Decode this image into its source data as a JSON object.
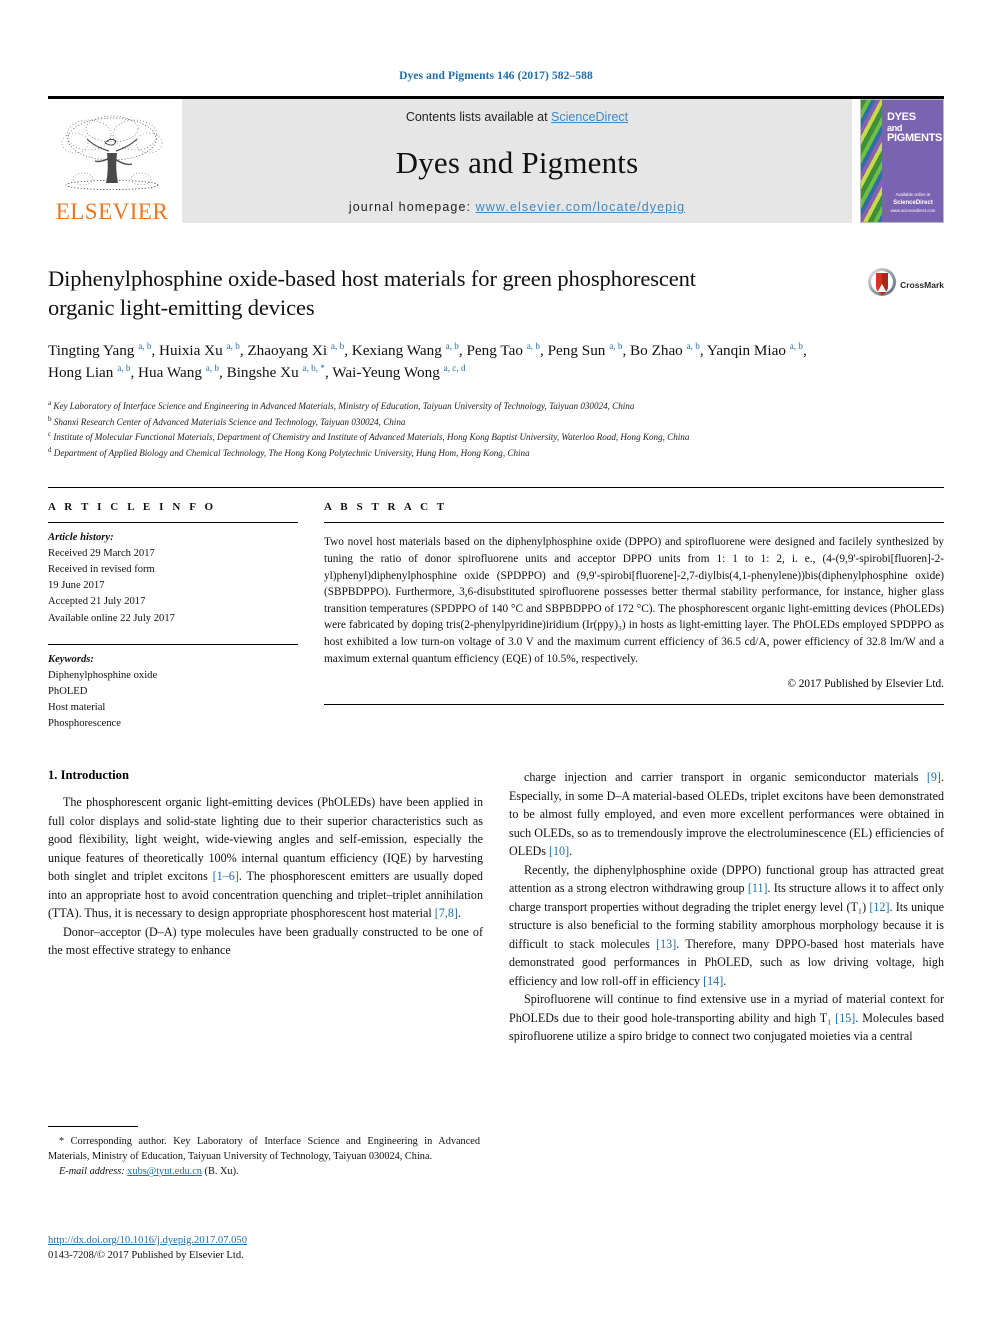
{
  "running_head": "Dyes and Pigments 146 (2017) 582–588",
  "masthead": {
    "publisher_name": "ELSEVIER",
    "contents_prefix": "Contents lists available at ",
    "contents_link": "ScienceDirect",
    "journal_title": "Dyes and Pigments",
    "homepage_prefix": "journal homepage: ",
    "homepage_url": "www.elsevier.com/locate/dyepig",
    "cover": {
      "line1": "DYES",
      "line2": "and",
      "line3": "PIGMENTS",
      "foot_small": "Available online at",
      "foot_brand": "ScienceDirect",
      "foot_url": "www.sciencedirect.com"
    }
  },
  "article": {
    "title": "Diphenylphosphine oxide-based host materials for green phosphorescent organic light-emitting devices",
    "crossmark_label": "CrossMark",
    "authors_html": "Tingting Yang <sup>a, b</sup>, Huixia Xu <sup>a, b</sup>, Zhaoyang Xi <sup>a, b</sup>, Kexiang Wang <sup>a, b</sup>, Peng Tao <sup>a, b</sup>, Peng Sun <sup>a, b</sup>, Bo Zhao <sup>a, b</sup>, Yanqin Miao <sup>a, b</sup>, Hong Lian <sup>a, b</sup>, Hua Wang <sup>a, b</sup>, Bingshe Xu <sup>a, b, *</sup>, Wai-Yeung Wong <sup>a, c, d</sup>",
    "affiliations": [
      {
        "marker": "a",
        "text": "Key Laboratory of Interface Science and Engineering in Advanced Materials, Ministry of Education, Taiyuan University of Technology, Taiyuan 030024, China"
      },
      {
        "marker": "b",
        "text": "Shanxi Research Center of Advanced Materials Science and Technology, Taiyuan 030024, China"
      },
      {
        "marker": "c",
        "text": "Institute of Molecular Functional Materials, Department of Chemistry and Institute of Advanced Materials, Hong Kong Baptist University, Waterloo Road, Hong Kong, China"
      },
      {
        "marker": "d",
        "text": "Department of Applied Biology and Chemical Technology, The Hong Kong Polytechnic University, Hung Hom, Hong Kong, China"
      }
    ]
  },
  "article_info": {
    "heading": "A R T I C L E  I N F O",
    "history_label": "Article history:",
    "history": [
      "Received 29 March 2017",
      "Received in revised form",
      "19 June 2017",
      "Accepted 21 July 2017",
      "Available online 22 July 2017"
    ],
    "keywords_label": "Keywords:",
    "keywords": [
      "Diphenylphosphine oxide",
      "PhOLED",
      "Host material",
      "Phosphorescence"
    ]
  },
  "abstract": {
    "heading": "A B S T R A C T",
    "text": "Two novel host materials based on the diphenylphosphine oxide (DPPO) and spirofluorene were designed and facilely synthesized by tuning the ratio of donor spirofluorene units and acceptor DPPO units from 1: 1 to 1: 2, i. e., (4-(9,9'-spirobi[fluoren]-2-yl)phenyl)diphenylphosphine oxide (SPDPPO) and (9,9'-spirobi[fluorene]-2,7-diylbis(4,1-phenylene))bis(diphenylphosphine oxide) (SBPBDPPO). Furthermore, 3,6-disubstituted spirofluorene possesses better thermal stability performance, for instance, higher glass transition temperatures (SPDPPO of 140 °C and SBPBDPPO of 172 °C). The phosphorescent organic light-emitting devices (PhOLEDs) were fabricated by doping tris(2-phenylpyridine)iridium (Ir(ppy)₃) in hosts as light-emitting layer. The PhOLEDs employed SPDPPO as host exhibited a low turn-on voltage of 3.0 V and the maximum current efficiency of 36.5 cd/A, power efficiency of 32.8 lm/W and a maximum external quantum efficiency (EQE) of 10.5%, respectively.",
    "copyright": "© 2017 Published by Elsevier Ltd."
  },
  "body": {
    "section_number_title": "1.  Introduction",
    "left_paragraphs": [
      "The phosphorescent organic light-emitting devices (PhOLEDs) have been applied in full color displays and solid-state lighting due to their superior characteristics such as good flexibility, light weight, wide-viewing angles and self-emission, especially the unique features of theoretically 100% internal quantum efficiency (IQE) by harvesting both singlet and triplet excitons [1–6]. The phosphorescent emitters are usually doped into an appropriate host to avoid concentration quenching and triplet–triplet annihilation (TTA). Thus, it is necessary to design appropriate phosphorescent host material [7,8].",
      "Donor–acceptor (D–A) type molecules have been gradually constructed to be one of the most effective strategy to enhance"
    ],
    "right_paragraphs": [
      "charge injection and carrier transport in organic semiconductor materials [9]. Especially, in some D–A material-based OLEDs, triplet excitons have been demonstrated to be almost fully employed, and even more excellent performances were obtained in such OLEDs, so as to tremendously improve the electroluminescence (EL) efficiencies of OLEDs [10].",
      "Recently, the diphenylphosphine oxide (DPPO) functional group has attracted great attention as a strong electron withdrawing group [11]. Its structure allows it to affect only charge transport properties without degrading the triplet energy level (T₁) [12]. Its unique structure is also beneficial to the forming stability amorphous morphology because it is difficult to stack molecules [13]. Therefore, many DPPO-based host materials have demonstrated good performances in PhOLED, such as low driving voltage, high efficiency and low roll-off in efficiency [14].",
      "Spirofluorene will continue to find extensive use in a myriad of material context for PhOLEDs due to their good hole-transporting ability and high T₁ [15]. Molecules based spirofluorene utilize a spiro bridge to connect two conjugated moieties via a central"
    ]
  },
  "footnotes": {
    "corresponding": "* Corresponding author. Key Laboratory of Interface Science and Engineering in Advanced Materials, Ministry of Education, Taiyuan University of Technology, Taiyuan 030024, China.",
    "email_label": "E-mail address:",
    "email": "xubs@tyut.edu.cn",
    "email_suffix": "(B. Xu).",
    "doi": "http://dx.doi.org/10.1016/j.dyepig.2017.07.050",
    "issn_line": "0143-7208/© 2017 Published by Elsevier Ltd."
  },
  "colors": {
    "link_blue": "#1f6fa8",
    "sciencedirect_blue": "#3d88c4",
    "elsevier_orange": "#E87722",
    "masthead_gray": "#e6e6e6",
    "cover_purple": "#7a63b0"
  }
}
